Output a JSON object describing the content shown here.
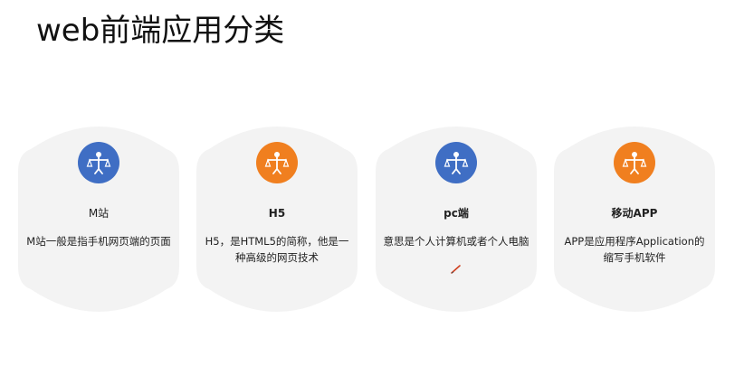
{
  "slide": {
    "title": "web前端应用分类"
  },
  "colors": {
    "card_bg": "#f3f3f3",
    "blue": "#3f6ec4",
    "orange": "#f07f1f"
  },
  "cards": [
    {
      "title": "M站",
      "desc": "M站一般是指手机网页端的页面",
      "icon": "balance-person-icon",
      "color": "#3f6ec4"
    },
    {
      "title": "H5",
      "desc": "H5，是HTML5的简称，他是一种高级的网页技术",
      "icon": "balance-person-icon",
      "color": "#f07f1f"
    },
    {
      "title": "pc端",
      "desc": "意思是个人计算机或者个人电脑",
      "icon": "balance-person-icon",
      "color": "#3f6ec4"
    },
    {
      "title": "移动APP",
      "desc": "APP是应用程序Application的缩写手机软件",
      "icon": "balance-person-icon",
      "color": "#f07f1f"
    }
  ]
}
